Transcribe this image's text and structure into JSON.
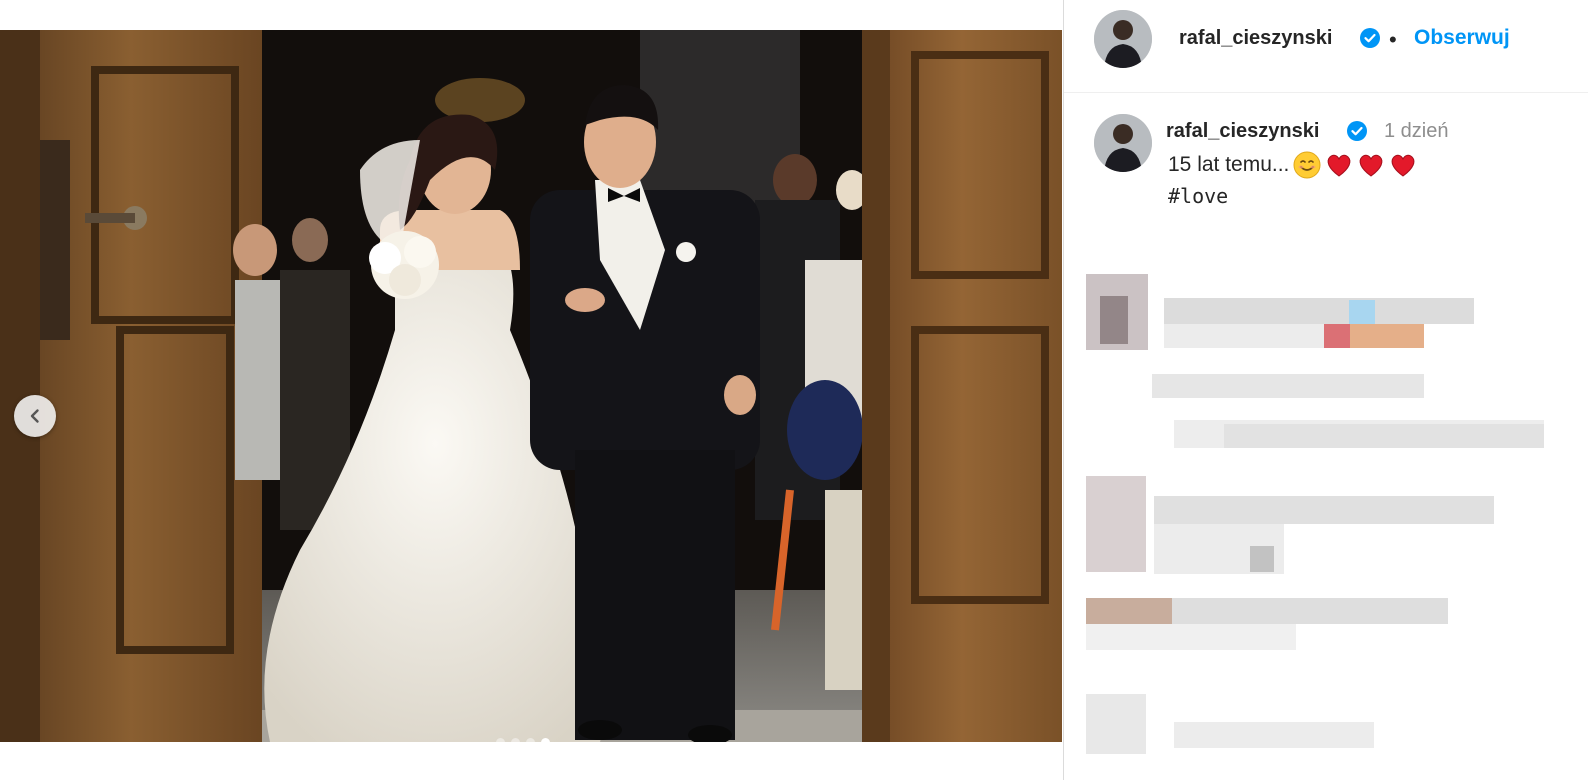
{
  "post": {
    "image_description_icon": "wedding-photo",
    "carousel": {
      "slide_count": 4,
      "active_index": 3
    }
  },
  "header": {
    "username": "rafal_cieszynski",
    "separator": "•",
    "follow_label": "Obserwuj"
  },
  "caption": {
    "username": "rafal_cieszynski",
    "time": "1 dzień",
    "text": "15 lat temu...",
    "emojis": [
      "smiling-face-icon",
      "red-heart-icon",
      "red-heart-icon",
      "red-heart-icon"
    ],
    "hashtag": "#love"
  },
  "colors": {
    "link_blue": "#0095f6",
    "verified_blue": "#0095f6",
    "text_primary": "#262626",
    "text_secondary": "#8e8e8e"
  }
}
